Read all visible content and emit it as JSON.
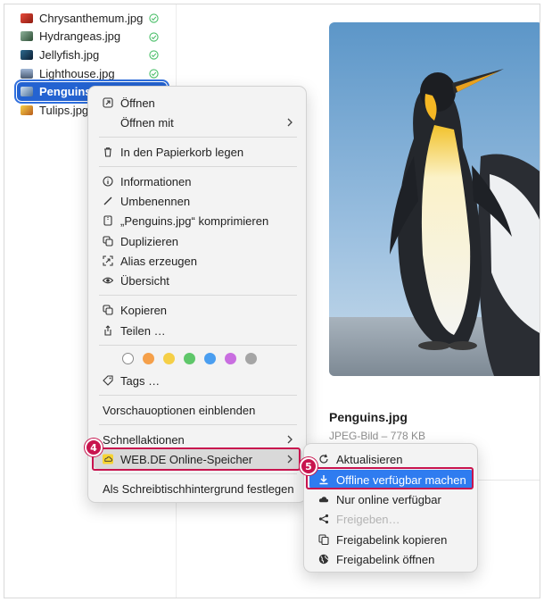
{
  "files": [
    {
      "name": "Chrysanthemum.jpg",
      "synced": true,
      "thumb_color": "#c0392b"
    },
    {
      "name": "Hydrangeas.jpg",
      "synced": true,
      "thumb_color": "#3f6b4a"
    },
    {
      "name": "Jellyfish.jpg",
      "synced": true,
      "thumb_color": "#1a3c5a"
    },
    {
      "name": "Lighthouse.jpg",
      "synced": true,
      "thumb_color": "#6b7fa3"
    },
    {
      "name": "Penguins.jpg",
      "synced": false,
      "selected": true,
      "thumb_color": "#4a6f9a"
    },
    {
      "name": "Tulips.jpg",
      "synced": false,
      "thumb_color": "#d4a017"
    }
  ],
  "preview": {
    "title": "Penguins.jpg",
    "meta": "JPEG-Bild – 778 KB"
  },
  "context_menu": {
    "open": "Öffnen",
    "open_with": "Öffnen mit",
    "trash": "In den Papierkorb legen",
    "info": "Informationen",
    "rename": "Umbenennen",
    "compress": "„Penguins.jpg“ komprimieren",
    "duplicate": "Duplizieren",
    "alias": "Alias erzeugen",
    "overview": "Übersicht",
    "copy": "Kopieren",
    "share": "Teilen …",
    "tag_colors": [
      "#ffffff",
      "#f5a04a",
      "#f5cf47",
      "#5fc76a",
      "#4a9ef0",
      "#c96ee0",
      "#a5a5a5"
    ],
    "tags": "Tags …",
    "preview_options": "Vorschauoptionen einblenden",
    "quick_actions": "Schnellaktionen",
    "webde": "WEB.DE Online-Speicher",
    "desktop_bg": "Als Schreibtischhintergrund festlegen"
  },
  "submenu": {
    "refresh": "Aktualisieren",
    "offline": "Offline verfügbar machen",
    "online_only": "Nur online verfügbar",
    "share": "Freigeben…",
    "copy_link": "Freigabelink kopieren",
    "open_link": "Freigabelink öffnen"
  },
  "callouts": {
    "step4": "4",
    "step5": "5"
  },
  "colors": {
    "accent": "#2f7cf0",
    "callout": "#c8144e",
    "selection": "#2463d1"
  }
}
